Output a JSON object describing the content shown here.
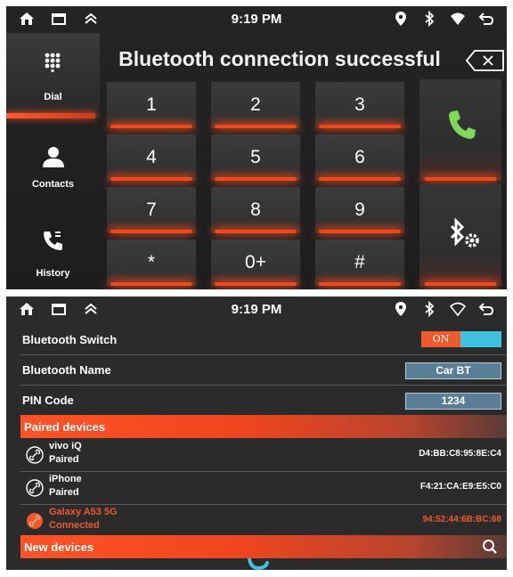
{
  "dial_screen": {
    "status": {
      "time": "9:19 PM"
    },
    "title": "Bluetooth connection successful",
    "sidebar": [
      {
        "label": "Dial",
        "icon": "dialpad-icon",
        "active": true
      },
      {
        "label": "Contacts",
        "icon": "contact-icon",
        "active": false
      },
      {
        "label": "History",
        "icon": "call-history-icon",
        "active": false
      }
    ],
    "keys": [
      "1",
      "2",
      "3",
      "4",
      "5",
      "6",
      "7",
      "8",
      "9",
      "*",
      "0+",
      "#"
    ],
    "call_button_icon": "phone-call-icon",
    "bt_settings_button_icon": "bluetooth-settings-icon",
    "colors": {
      "accent": "#f04818",
      "call_green": "#7ed957"
    }
  },
  "settings_screen": {
    "status": {
      "time": "9:19 PM"
    },
    "bluetooth_switch": {
      "label": "Bluetooth Switch",
      "state": "ON"
    },
    "bluetooth_name": {
      "label": "Bluetooth Name",
      "value": "Car BT"
    },
    "pin_code": {
      "label": "PIN Code",
      "value": "1234"
    },
    "paired_header": "Paired devices",
    "paired_devices": [
      {
        "name": "vivo iQ",
        "status": "Paired",
        "mac": "D4:BB:C8:95:8E:C4",
        "connected": false
      },
      {
        "name": "iPhone",
        "status": "Paired",
        "mac": "F4:21:CA:E9:E5:C0",
        "connected": false
      },
      {
        "name": "Galaxy A53 5G",
        "status": "Connected",
        "mac": "94:52:44:6B:BC:68",
        "connected": true
      }
    ],
    "new_devices_header": "New devices",
    "colors": {
      "accent": "#f05a2a",
      "toggle_off": "#3fc2e0",
      "pill": "#5a7d98"
    }
  }
}
